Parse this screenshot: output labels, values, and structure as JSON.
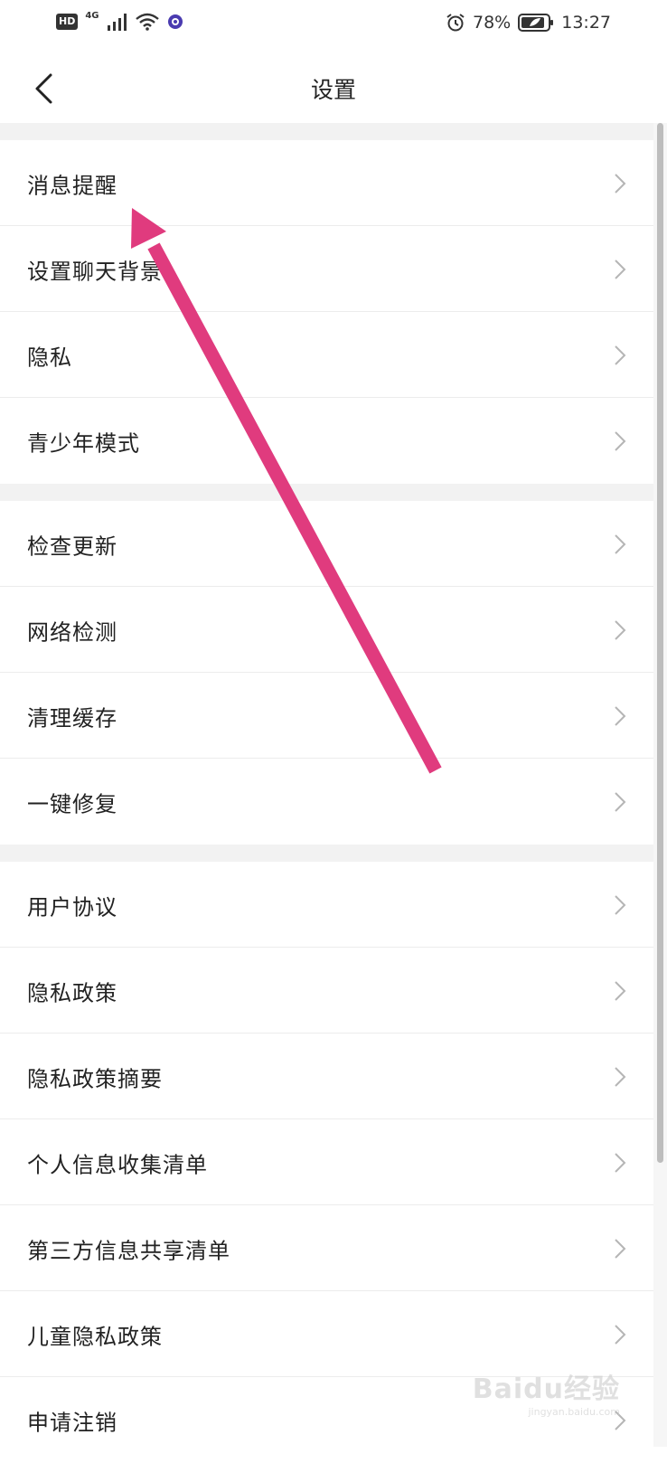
{
  "status_bar": {
    "hd": "HD",
    "network": "4G",
    "battery": "78%",
    "time": "13:27",
    "icons": [
      "signal-icon",
      "wifi-icon",
      "app-notification-icon",
      "alarm-icon",
      "battery-icon"
    ]
  },
  "header": {
    "back_icon": "chevron-left-icon",
    "title": "设置"
  },
  "sections": [
    {
      "items": [
        {
          "label": "消息提醒"
        },
        {
          "label": "设置聊天背景"
        },
        {
          "label": "隐私"
        },
        {
          "label": "青少年模式"
        }
      ]
    },
    {
      "items": [
        {
          "label": "检查更新"
        },
        {
          "label": "网络检测"
        },
        {
          "label": "清理缓存"
        },
        {
          "label": "一键修复"
        }
      ]
    },
    {
      "items": [
        {
          "label": "用户协议"
        },
        {
          "label": "隐私政策"
        },
        {
          "label": "隐私政策摘要"
        },
        {
          "label": "个人信息收集清单"
        },
        {
          "label": "第三方信息共享清单"
        },
        {
          "label": "儿童隐私政策"
        },
        {
          "label": "申请注销"
        }
      ]
    }
  ],
  "annotation": {
    "color": "#e03b7e"
  },
  "watermark": {
    "main": "Baidu经验",
    "sub": "jingyan.baidu.com"
  }
}
